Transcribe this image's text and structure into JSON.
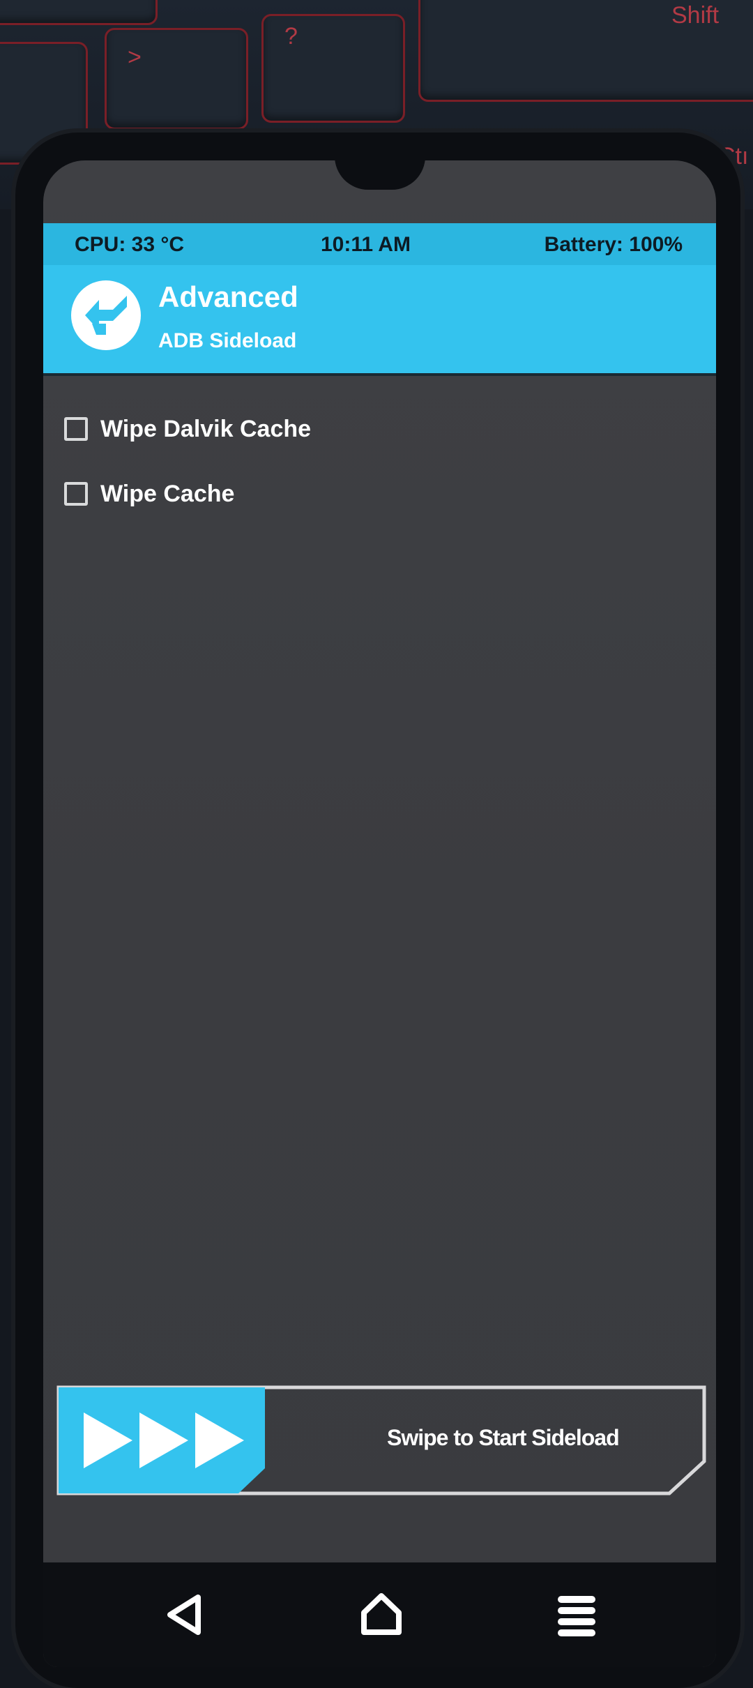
{
  "keyboard": {
    "shift_label": "Shift",
    "ctrl_label": "Ctı",
    "question_label": "?",
    "gt_label": ">"
  },
  "status": {
    "cpu": "CPU: 33 °C",
    "time": "10:11 AM",
    "battery": "Battery: 100%"
  },
  "header": {
    "title": "Advanced",
    "subtitle": "ADB Sideload",
    "logo_icon": "twrp-logo-icon"
  },
  "options": [
    {
      "label": "Wipe Dalvik Cache",
      "checked": false
    },
    {
      "label": "Wipe Cache",
      "checked": false
    }
  ],
  "swipe": {
    "label": "Swipe to Start Sideload",
    "arrow_icon": "triple-arrow-icon"
  },
  "nav": {
    "back_icon": "back-icon",
    "home_icon": "home-icon",
    "menu_icon": "menu-icon"
  },
  "colors": {
    "accent": "#34c3ee",
    "background": "#3d3e42",
    "text": "#ffffff"
  }
}
